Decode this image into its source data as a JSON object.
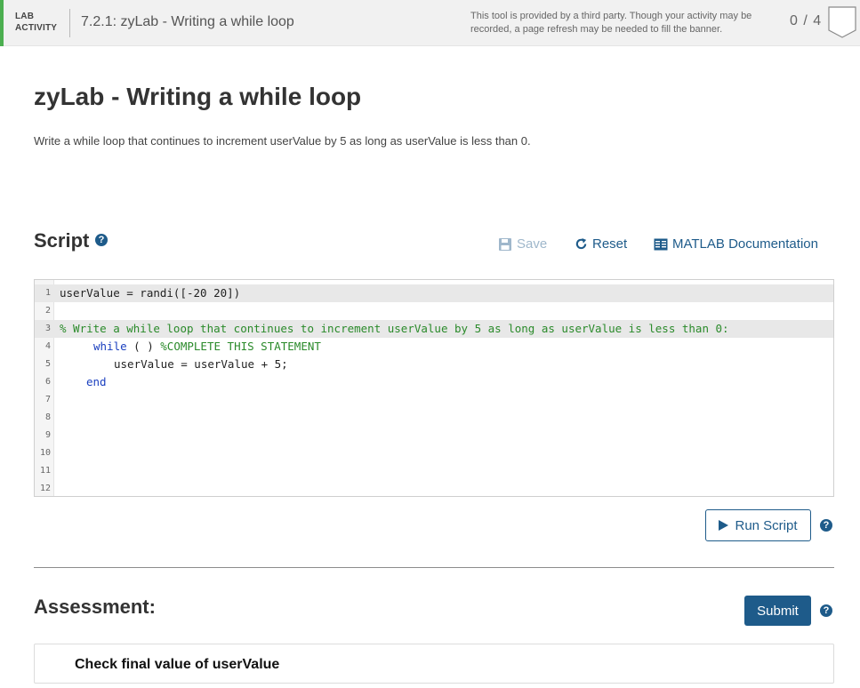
{
  "banner": {
    "lab_line1": "LAB",
    "lab_line2": "ACTIVITY",
    "activity_title": "7.2.1: zyLab - Writing a while loop",
    "notice_line1": "This tool is provided by a third party. Though your activity may be",
    "notice_line2": "recorded, a page refresh may be needed to fill the banner.",
    "score": "0 / 4",
    "accent_color": "#4caf50"
  },
  "page": {
    "title": "zyLab - Writing a while loop",
    "description": "Write a while loop that continues to increment userValue by 5 as long as userValue is less than 0."
  },
  "script": {
    "heading": "Script",
    "help_icon": "question-circle-icon",
    "save_label": "Save",
    "reset_label": "Reset",
    "docs_label": "MATLAB Documentation",
    "run_label": "Run Script",
    "code_lines": [
      {
        "n": "1",
        "highlight": true
      },
      {
        "n": "2",
        "highlight": false
      },
      {
        "n": "3",
        "highlight": true
      },
      {
        "n": "4",
        "highlight": false
      },
      {
        "n": "5",
        "highlight": false
      },
      {
        "n": "6",
        "highlight": false
      },
      {
        "n": "7",
        "highlight": false
      },
      {
        "n": "8",
        "highlight": false
      },
      {
        "n": "9",
        "highlight": false
      },
      {
        "n": "10",
        "highlight": false
      },
      {
        "n": "11",
        "highlight": false
      },
      {
        "n": "12",
        "highlight": false
      }
    ],
    "code": {
      "l1": "userValue = randi([-20 20])",
      "l3": "% Write a while loop that continues to increment userValue by 5 as long as userValue is less than 0:",
      "l4_kw": "while",
      "l4_rest": " ( ) ",
      "l4_comment": "%COMPLETE THIS STATEMENT",
      "l5": "userValue = userValue + 5;",
      "l6_kw": "end"
    }
  },
  "assessment": {
    "heading": "Assessment:",
    "submit_label": "Submit",
    "check_label": "Check final value of userValue"
  },
  "colors": {
    "brand_blue": "#1e5b8a",
    "keyword": "#1a3fbf",
    "comment": "#2a8a2a"
  }
}
